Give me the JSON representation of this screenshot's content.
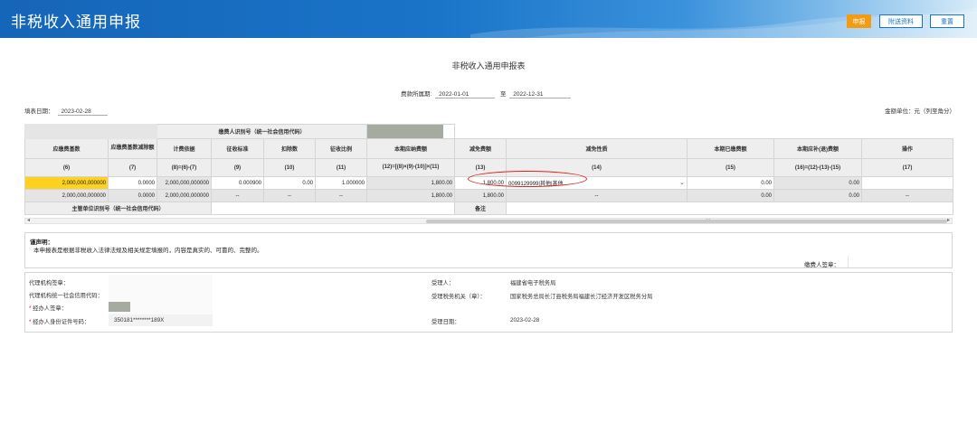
{
  "header": {
    "title": "非税收入通用申报",
    "submit_label": "申报",
    "attach_label": "附送资料",
    "reset_label": "重置"
  },
  "form": {
    "title": "非税收入通用申报表",
    "period_label": "费款所属期:",
    "period_start": "2022-01-01",
    "period_to": "至",
    "period_end": "2022-12-31",
    "fill_date_label": "填表日期：",
    "fill_date": "2023-02-28",
    "unit_label": "金额单位：元（列至角分）"
  },
  "table": {
    "payer_id_label": "缴费人识别号（统一社会信用代码）",
    "headers": [
      "应缴费基数",
      "应缴费基数减除额",
      "计费依据",
      "征收标准",
      "扣除数",
      "征收比例",
      "本期应纳费额",
      "减免费额",
      "减免性质",
      "本期已缴费额",
      "本期应补(退)费额",
      "操作"
    ],
    "col_nums": [
      "(6)",
      "(7)",
      "(8)=(6)-(7)",
      "(9)",
      "(10)",
      "(11)",
      "(12)=[(8)×(9)-(10)]×(11)",
      "(13)",
      "(14)",
      "(15)",
      "(16)=(12)-(13)-(15)",
      "(17)"
    ],
    "row1": [
      "2,000,000,000000",
      "0.0000",
      "2,000,000,000000",
      "0.000900",
      "0.00",
      "1.000000",
      "1,800.00",
      "1,800.00",
      "0099129999|其他|其他",
      "0.00",
      "0.00",
      ""
    ],
    "row2": [
      "2,000,000,000000",
      "0.0000",
      "2,000,000,000000",
      "--",
      "--",
      "--",
      "1,800.00",
      "1,800.00",
      "--",
      "0.00",
      "0.00",
      "--"
    ],
    "dept_id_label": "主管单位识别号（统一社会信用代码）",
    "remark_label": "备注",
    "scroll_dots": "..."
  },
  "declaration": {
    "title": "谨声明：",
    "text": "本申报表是根据非税收入法律法规及相关规定填报的，内容是真实的、可靠的、完整的。",
    "sign_label": "缴费人签章："
  },
  "bottom": {
    "agent_seal_label": "代理机构签章：",
    "agent_code_label": "代理机构统一社会信用代码：",
    "handler_sign_label": "经办人签章：",
    "handler_id_label": "经办人身份证件号码：",
    "handler_id": "350181********189X",
    "receiver_label": "受理人：",
    "receiver": "福建省电子税务局",
    "tax_office_label": "受理税务机关（章）：",
    "tax_office": "国家税务总局长汀县税务局福建长汀经济开发区税务分局",
    "accept_date_label": "受理日期：",
    "accept_date": "2023-02-28"
  },
  "colors": {
    "header_blue": "#1a74c8",
    "submit_orange": "#f39c12",
    "highlight_yellow": "#ffd21f",
    "oval_red": "#e0201a"
  }
}
